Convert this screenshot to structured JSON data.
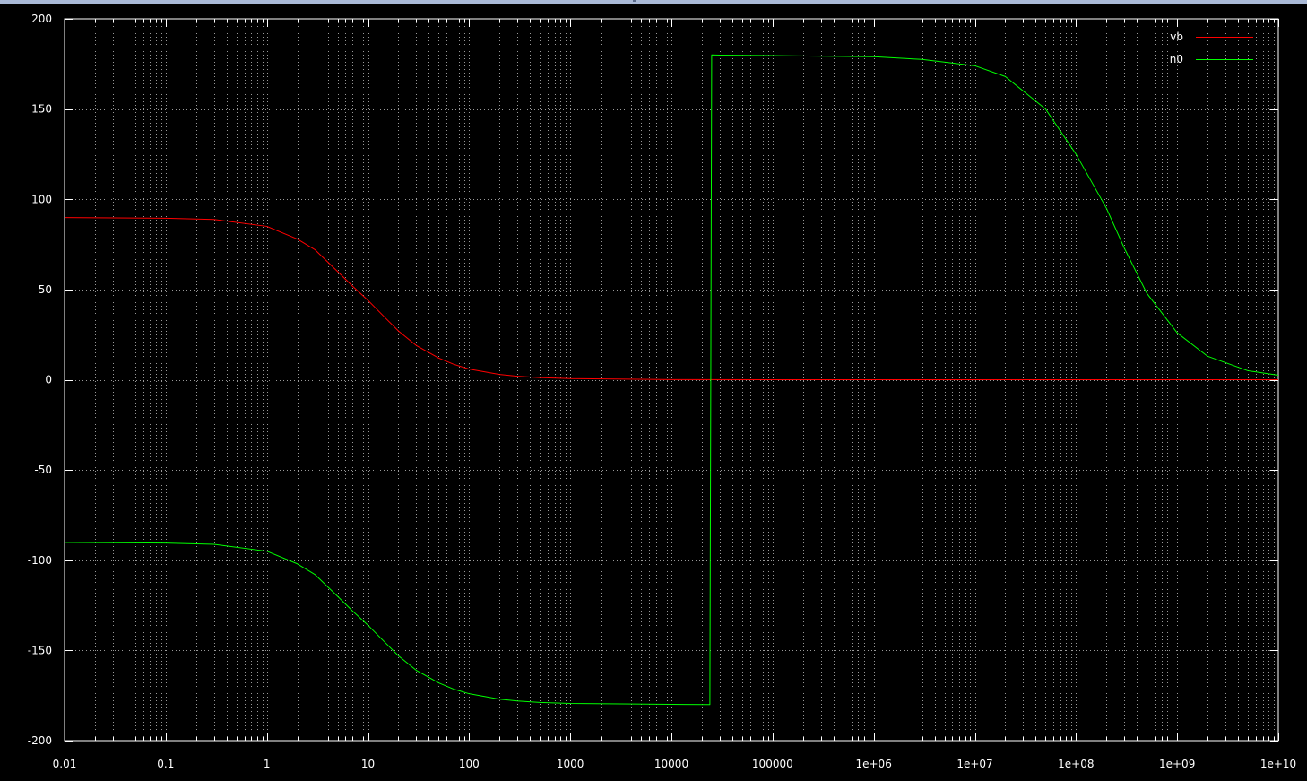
{
  "chart_data": {
    "type": "line",
    "title": "",
    "xlabel": "",
    "ylabel": "",
    "xscale": "log",
    "xlim": [
      0.01,
      10000000000
    ],
    "ylim": [
      -200,
      200
    ],
    "grid": true,
    "legend": "top-right",
    "background": "#000000",
    "x_tick_labels": [
      "0.01",
      "0.1",
      "1",
      "10",
      "100",
      "1000",
      "10000",
      "100000",
      "1e+06",
      "1e+07",
      "1e+08",
      "1e+09",
      "1e+10"
    ],
    "y_tick_labels": [
      "200",
      "150",
      "100",
      "50",
      "0",
      "-50",
      "-100",
      "-150",
      "-200"
    ],
    "series": [
      {
        "name": "vb",
        "color": "#ff0000",
        "x": [
          0.01,
          0.1,
          0.3,
          1,
          2,
          3,
          5,
          7,
          10,
          15,
          20,
          30,
          50,
          70,
          100,
          200,
          300,
          500,
          1000,
          10000,
          100000,
          1000000,
          10000000,
          100000000,
          1000000000,
          10000000000
        ],
        "y": [
          89.9,
          89.5,
          88.8,
          85,
          78,
          72,
          60,
          52,
          44,
          34,
          27,
          19,
          12,
          8.6,
          5.9,
          2.9,
          1.9,
          1.2,
          0.6,
          0.06,
          0,
          0,
          0,
          0,
          0,
          0
        ]
      },
      {
        "name": "n0",
        "color": "#00ff00",
        "x": [
          0.01,
          0.1,
          0.3,
          1,
          2,
          3,
          5,
          7,
          10,
          15,
          20,
          30,
          50,
          70,
          100,
          200,
          300,
          500,
          1000,
          10000,
          24000,
          25000,
          30000,
          100000,
          1000000,
          3000000,
          10000000,
          20000000,
          50000000,
          100000000,
          200000000,
          300000000,
          500000000,
          1000000000,
          2000000000,
          5000000000,
          10000000000
        ],
        "y": [
          -90.1,
          -90.5,
          -91.2,
          -95,
          -102,
          -108,
          -120,
          -128,
          -136,
          -146,
          -153,
          -161,
          -168,
          -171.4,
          -174,
          -177,
          -178,
          -178.8,
          -179.4,
          -179.9,
          -180,
          180,
          179.9,
          179.6,
          179,
          177.5,
          174,
          168,
          150,
          125,
          95,
          73,
          48,
          26,
          13,
          5,
          2.5
        ]
      }
    ]
  }
}
